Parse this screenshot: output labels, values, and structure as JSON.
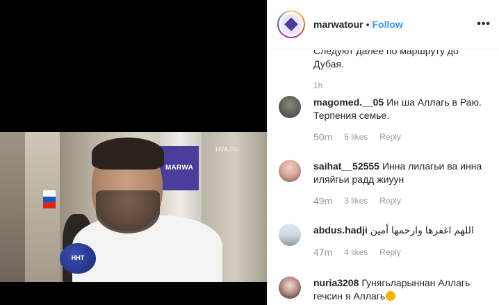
{
  "media": {
    "sign_text": "MARWA",
    "watermark": "HVA.RU",
    "mic_text": "HHT"
  },
  "header": {
    "username": "marwatour",
    "separator": "•",
    "follow_label": "Follow",
    "more_label": "•••"
  },
  "previous_comment": {
    "text": "Следуют далее по маршруту до Дубая.",
    "time": "1h"
  },
  "comments": [
    {
      "user": "magomed.__05",
      "text": "Ин ша Аллагь в Раю. Терпения семье.",
      "time": "50m",
      "likes": "5 likes",
      "reply": "Reply"
    },
    {
      "user": "saihat__52555",
      "text": "Инна лилагьи ва инна иляйгьи радд жиуун",
      "time": "49m",
      "likes": "3 likes",
      "reply": "Reply"
    },
    {
      "user": "abdus.hadji",
      "text": "اللهم اغفرها وارحمها أمين",
      "time": "47m",
      "likes": "4 likes",
      "reply": "Reply"
    },
    {
      "user": "nuria3208",
      "text": "Гунягьларыннан Аллагь гечсин я Аллагь",
      "time": "",
      "likes": "",
      "reply": ""
    }
  ],
  "colors": {
    "follow_blue": "#3897f0",
    "meta_gray": "#999999",
    "brand_purple": "#4a3d9b"
  }
}
